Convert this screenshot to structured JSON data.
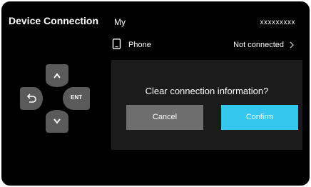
{
  "header": {
    "title": "Device Connection",
    "tab": "My",
    "device_name": "xxxxxxxxx"
  },
  "device_row": {
    "icon": "phone-icon",
    "label": "Phone",
    "status": "Not connected"
  },
  "dpad": {
    "up_icon": "chevron-up-icon",
    "down_icon": "chevron-down-icon",
    "back_icon": "back-arrow-icon",
    "ent_label": "ENT"
  },
  "dialog": {
    "message": "Clear connection information?",
    "cancel_label": "Cancel",
    "confirm_label": "Confirm"
  },
  "colors": {
    "background": "#000000",
    "dialog": "#1b1b1b",
    "cancel": "#6e6e6e",
    "confirm": "#35c6ee",
    "dpad_key": "#5a5a5a"
  }
}
